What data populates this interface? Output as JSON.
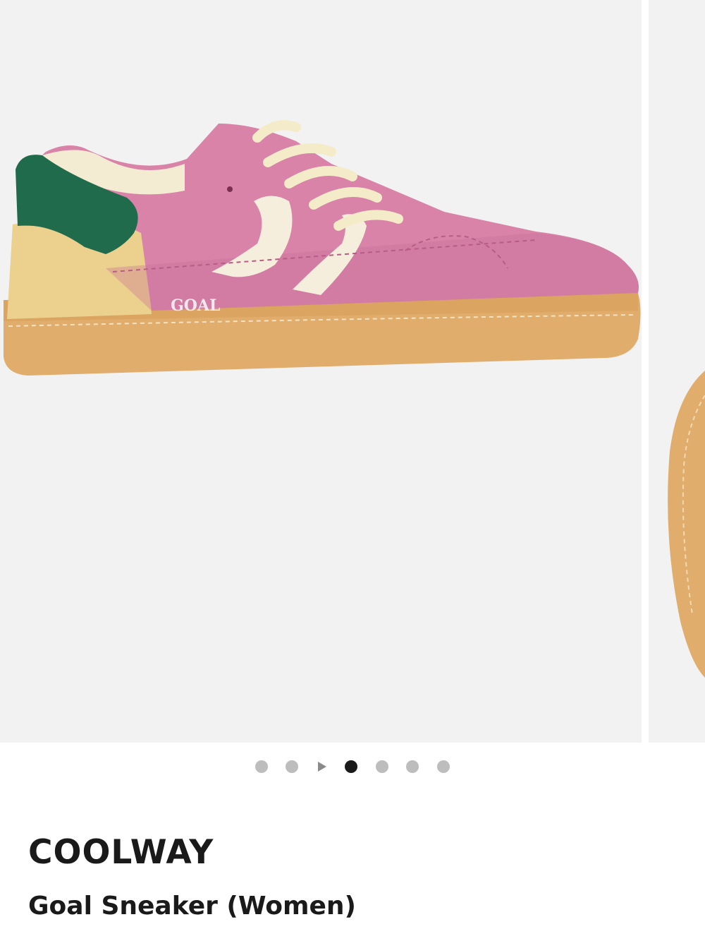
{
  "product": {
    "brand": "COOLWAY",
    "name": "Goal Sneaker (Women)",
    "image_subject": "pink-suede-sneaker-side-view",
    "shoe_logo_text": "GOAL",
    "colors": {
      "suede": "#d983a9",
      "stripes": "#f6eedc",
      "heel_tab": "#1f6b4c",
      "sole": "#e0ad6c",
      "laces": "#f4ecc9",
      "heel_counter": "#ecd08e"
    }
  },
  "gallery": {
    "total_images": 7,
    "current_index": 4,
    "video_indicator_after": 2
  }
}
